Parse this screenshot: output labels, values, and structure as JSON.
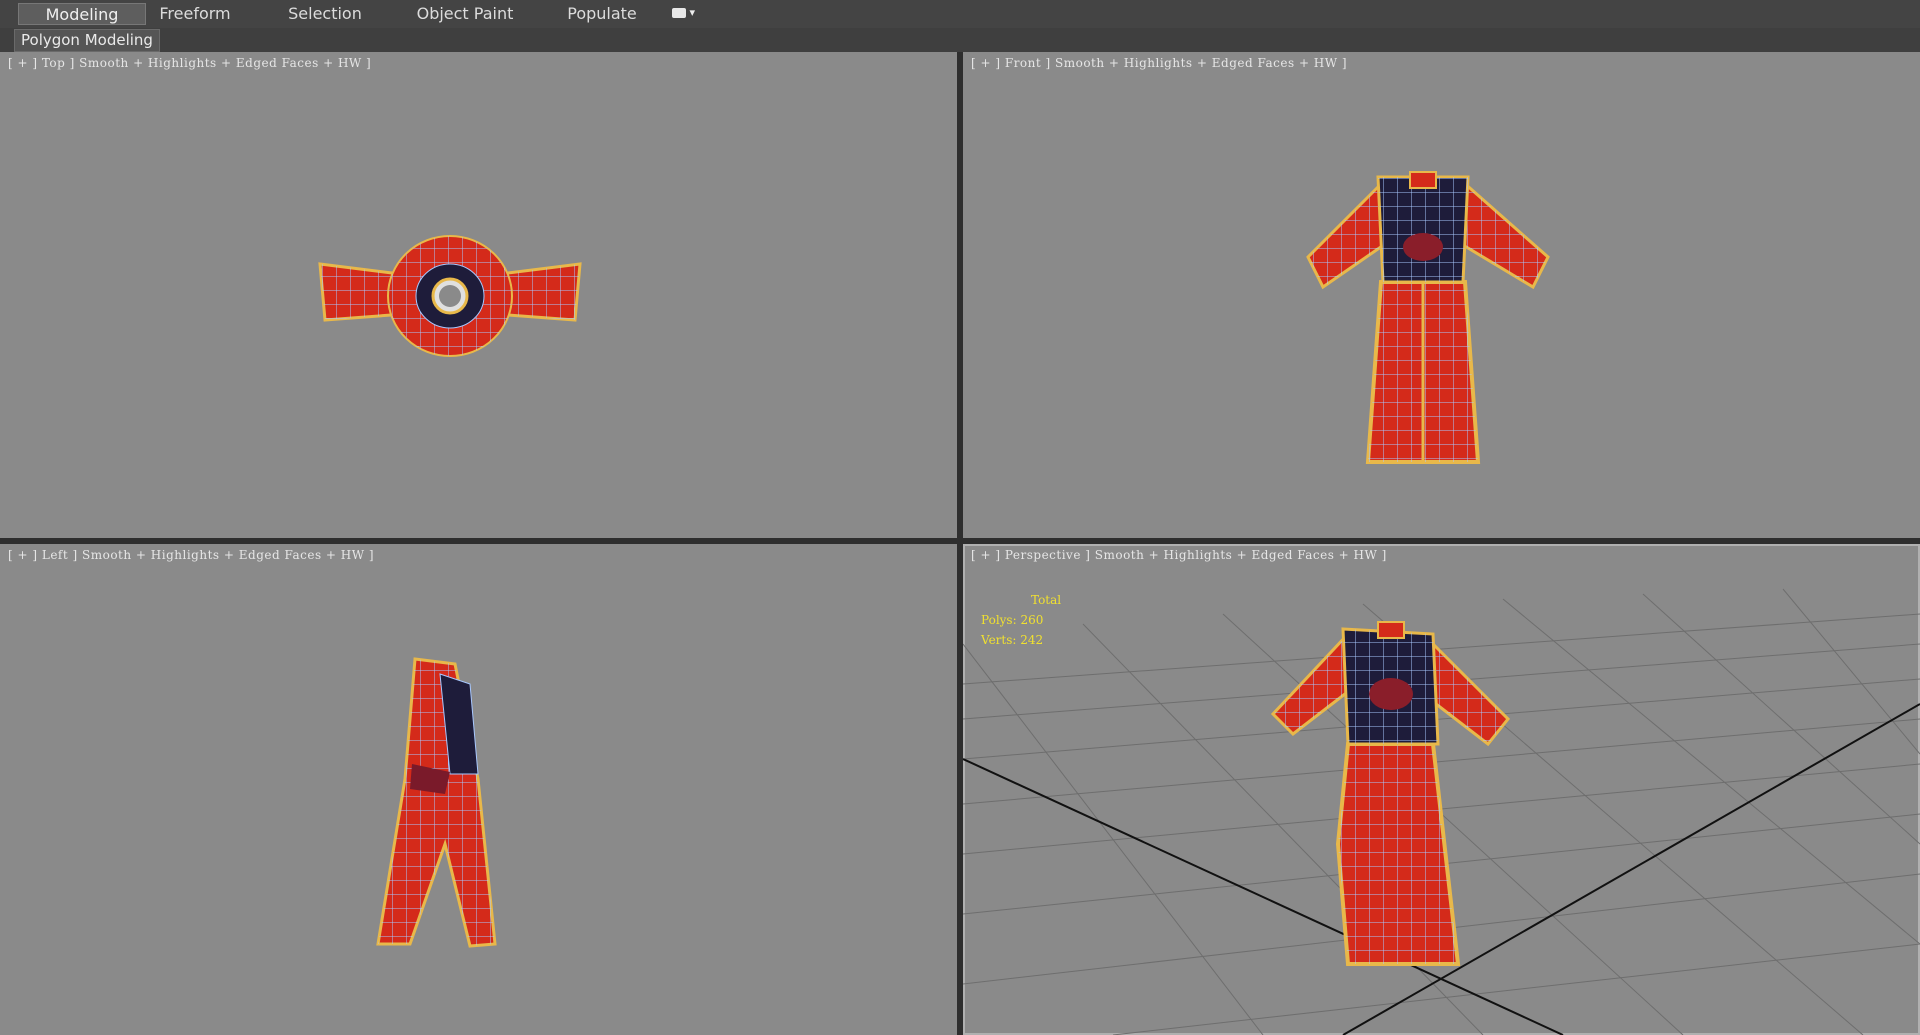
{
  "ribbon": {
    "tabs": [
      "Modeling",
      "Freeform",
      "Selection",
      "Object Paint",
      "Populate"
    ],
    "active_tab": "Modeling",
    "panel_title": "Polygon Modeling"
  },
  "viewports": {
    "top": {
      "label": "[ + ] Top ] Smooth + Highlights + Edged Faces + HW ]"
    },
    "front": {
      "label": "[ + ] Front ] Smooth + Highlights + Edged Faces + HW ]"
    },
    "left": {
      "label": "[ + ] Left ] Smooth + Highlights + Edged Faces + HW ]"
    },
    "perspective": {
      "label": "[ + ] Perspective ] Smooth + Highlights + Edged Faces + HW ]"
    }
  },
  "stats": {
    "total_label": "Total",
    "polys": "Polys: 260",
    "verts": "Verts: 242"
  },
  "colors": {
    "viewport_bg": "#8a8a8a",
    "robe_red": "#d42a1a",
    "robe_dark": "#1e1c3a",
    "trim_gold": "#e8b84a",
    "wire": "#a8c8ff",
    "stats_yellow": "#f0e030"
  }
}
